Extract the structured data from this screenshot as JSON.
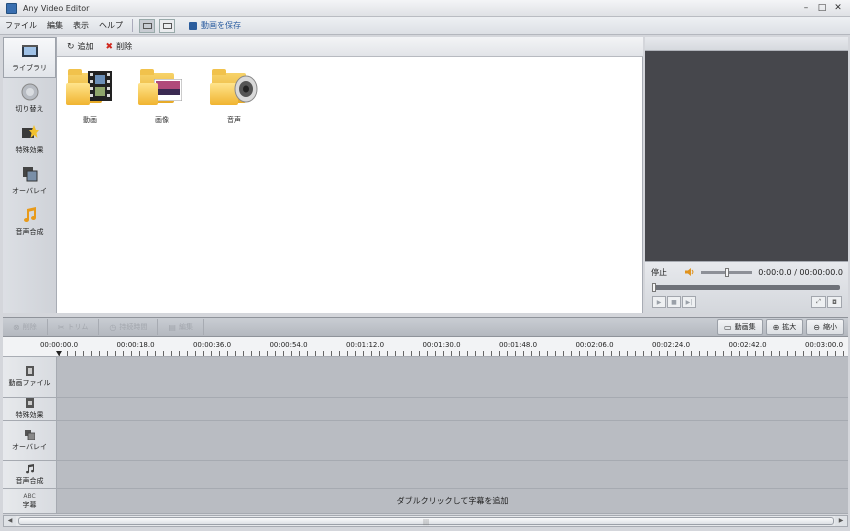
{
  "window": {
    "title": "Any Video Editor",
    "controls": [
      "–",
      "□",
      "✕"
    ]
  },
  "menu": {
    "items": [
      "ファイル",
      "編集",
      "表示",
      "ヘルプ"
    ],
    "save_label": "動画を保存"
  },
  "sidebar": {
    "items": [
      {
        "label": "ライブラリ",
        "icon": "library-icon"
      },
      {
        "label": "切り替え",
        "icon": "transition-icon"
      },
      {
        "label": "特殊効果",
        "icon": "effects-icon"
      },
      {
        "label": "オーバレイ",
        "icon": "overlay-icon"
      },
      {
        "label": "音声合成",
        "icon": "music-icon"
      }
    ]
  },
  "library": {
    "toolbar": {
      "add": "追加",
      "delete": "削除"
    },
    "folders": [
      {
        "label": "動画",
        "icon": "video-folder-icon"
      },
      {
        "label": "画像",
        "icon": "image-folder-icon"
      },
      {
        "label": "音声",
        "icon": "audio-folder-icon"
      }
    ]
  },
  "preview": {
    "status": "停止",
    "time": "0:00:0.0 / 00:00:00.0",
    "volume_level": 0.5,
    "seek_position": 0
  },
  "timeline": {
    "toolbar": {
      "delete": "削除",
      "trim": "トリム",
      "duration": "持続時間",
      "edit": "編集",
      "video_edit": "動画集",
      "zoom_in": "拡大",
      "zoom_out": "縮小"
    },
    "ruler": [
      "00:00:00.0",
      "00:00:18.0",
      "00:00:36.0",
      "00:00:54.0",
      "00:01:12.0",
      "00:01:30.0",
      "00:01:48.0",
      "00:02:06.0",
      "00:02:24.0",
      "00:02:42.0",
      "00:03:00.0"
    ],
    "tracks": [
      {
        "label": "動画ファイル",
        "icon": "film-track-icon"
      },
      {
        "label": "特殊効果",
        "icon": "effects-track-icon"
      },
      {
        "label": "オーバレイ",
        "icon": "overlay-track-icon"
      },
      {
        "label": "音声合成",
        "icon": "music-track-icon"
      },
      {
        "label": "字幕",
        "icon_text": "ABC"
      }
    ],
    "subtitle_hint": "ダブルクリックして字幕を追加"
  },
  "colors": {
    "accent": "#2b5da0",
    "delete": "#d0281f",
    "folder": "#f0b431"
  }
}
